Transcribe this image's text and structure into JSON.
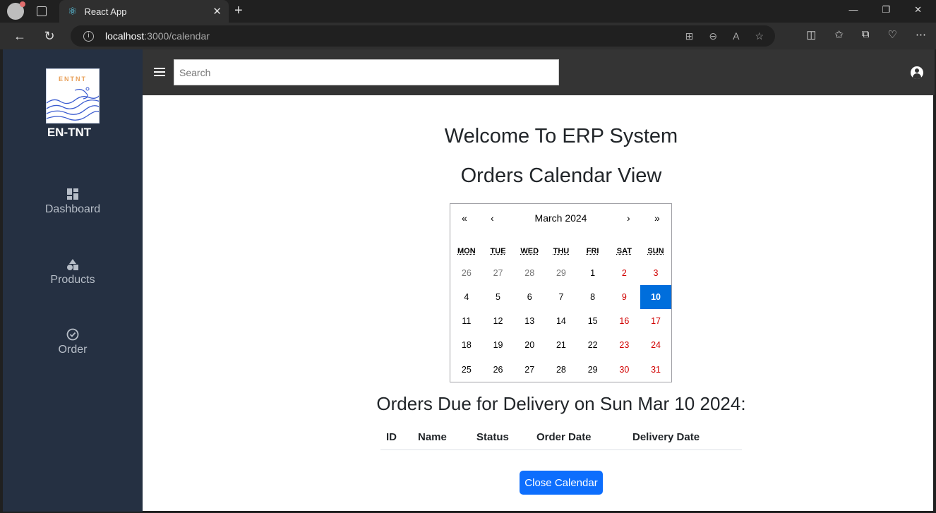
{
  "browser": {
    "tab_title": "React App",
    "url_host": "localhost",
    "url_path": ":3000/calendar"
  },
  "sidebar": {
    "brand": "EN-TNT",
    "logo_text": "ENTNT",
    "items": [
      {
        "label": "Dashboard",
        "icon": "dashboard-icon"
      },
      {
        "label": "Products",
        "icon": "shapes-icon"
      },
      {
        "label": "Order",
        "icon": "check-circle-icon"
      }
    ]
  },
  "topbar": {
    "search_placeholder": "Search"
  },
  "main": {
    "welcome": "Welcome To ERP System",
    "title": "Orders Calendar View",
    "due_heading": "Orders Due for Delivery on Sun Mar 10 2024:",
    "table_headers": [
      "ID",
      "Name",
      "Status",
      "Order Date",
      "Delivery Date"
    ],
    "close_button": "Close Calendar"
  },
  "calendar": {
    "nav_prev2": "«",
    "nav_prev": "‹",
    "month_label": "March 2024",
    "nav_next": "›",
    "nav_next2": "»",
    "weekdays": [
      "MON",
      "TUE",
      "WED",
      "THU",
      "FRI",
      "SAT",
      "SUN"
    ],
    "weeks": [
      [
        "26",
        "27",
        "28",
        "29",
        "1",
        "2",
        "3"
      ],
      [
        "4",
        "5",
        "6",
        "7",
        "8",
        "9",
        "10"
      ],
      [
        "11",
        "12",
        "13",
        "14",
        "15",
        "16",
        "17"
      ],
      [
        "18",
        "19",
        "20",
        "21",
        "22",
        "23",
        "24"
      ],
      [
        "25",
        "26",
        "27",
        "28",
        "29",
        "30",
        "31"
      ]
    ],
    "selected_day": "10"
  },
  "colors": {
    "accent": "#0d6efd",
    "selected_day": "#006edc",
    "weekend": "#d10000",
    "sidebar": "#253042"
  }
}
